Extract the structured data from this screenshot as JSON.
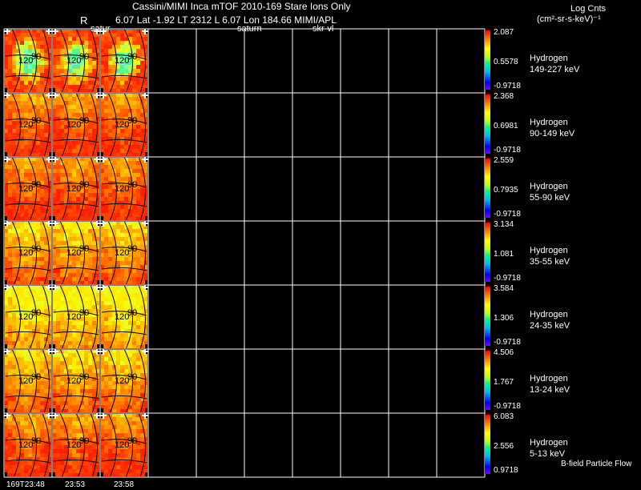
{
  "header": {
    "title": "Cassini/MIMI Inca mTOF  2010-169   Stare    Ions Only",
    "r_label": "R",
    "info_line": "6.07 Lat -1.92 LT 2312 L         6.07 Lon         184.66  MIMI/APL",
    "marker_saturn_1": "satur",
    "marker_saturn_2": "saturn",
    "marker_skr": "skr-vl",
    "units_title": "Log Cnts",
    "units": "(cm²-sr-s-keV)⁻¹"
  },
  "image_labels": {
    "inner": "120",
    "outer": "90"
  },
  "colors": {
    "background": "#000000",
    "grid": "#ffffff",
    "contour": "#000000"
  },
  "rows": [
    {
      "species": "Hydrogen",
      "energy": "149-227 keV",
      "cb_max": "2.087",
      "cb_mid": "0.5578",
      "cb_min": "-0.9718",
      "theme": "hot"
    },
    {
      "species": "Hydrogen",
      "energy": "90-149 keV",
      "cb_max": "2.368",
      "cb_mid": "0.6981",
      "cb_min": "-0.9718",
      "theme": "red"
    },
    {
      "species": "Hydrogen",
      "energy": "55-90 keV",
      "cb_max": "2.559",
      "cb_mid": "0.7935",
      "cb_min": "-0.9718",
      "theme": "red"
    },
    {
      "species": "Hydrogen",
      "energy": "35-55 keV",
      "cb_max": "3.134",
      "cb_mid": "1.081",
      "cb_min": "-0.9718",
      "theme": "orange"
    },
    {
      "species": "Hydrogen",
      "energy": "24-35 keV",
      "cb_max": "3.584",
      "cb_mid": "1.306",
      "cb_min": "-0.9718",
      "theme": "yellow"
    },
    {
      "species": "Hydrogen",
      "energy": "13-24 keV",
      "cb_max": "4.506",
      "cb_mid": "1.767",
      "cb_min": "-0.9718",
      "theme": "orange"
    },
    {
      "species": "Hydrogen",
      "energy": "5-13 keV",
      "cb_max": "6.083",
      "cb_mid": "2.556",
      "cb_min": "0.9718",
      "theme": "red"
    }
  ],
  "time_labels": [
    "169T23:48",
    "23:53",
    "23:58"
  ],
  "footer_note": "B-field Particle Flow"
}
